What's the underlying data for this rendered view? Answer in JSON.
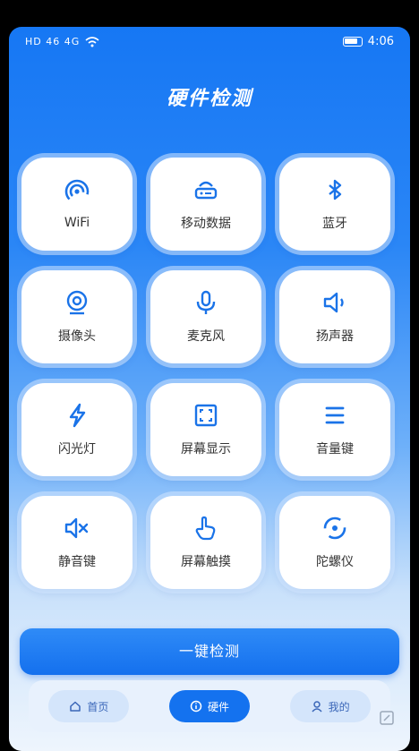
{
  "status_bar": {
    "time": "4:06",
    "signal_text": "HD 46 4G"
  },
  "header": {
    "title": "硬件检测"
  },
  "grid": {
    "items": [
      {
        "label": "WiFi",
        "icon": "wifi-icon"
      },
      {
        "label": "移动数据",
        "icon": "router-icon"
      },
      {
        "label": "蓝牙",
        "icon": "bluetooth-icon"
      },
      {
        "label": "摄像头",
        "icon": "camera-icon"
      },
      {
        "label": "麦克风",
        "icon": "microphone-icon"
      },
      {
        "label": "扬声器",
        "icon": "speaker-icon"
      },
      {
        "label": "闪光灯",
        "icon": "flash-icon"
      },
      {
        "label": "屏幕显示",
        "icon": "screen-icon"
      },
      {
        "label": "音量键",
        "icon": "volume-keys-icon"
      },
      {
        "label": "静音键",
        "icon": "mute-icon"
      },
      {
        "label": "屏幕触摸",
        "icon": "touch-icon"
      },
      {
        "label": "陀螺仪",
        "icon": "gyroscope-icon"
      }
    ]
  },
  "actions": {
    "check_all": "一键检测"
  },
  "nav": {
    "items": [
      {
        "label": "首页",
        "icon": "home-icon",
        "active": false
      },
      {
        "label": "硬件",
        "icon": "info-icon",
        "active": true
      },
      {
        "label": "我的",
        "icon": "user-icon",
        "active": false
      }
    ]
  },
  "colors": {
    "accent": "#1472ef",
    "icon_blue": "#1a73e8",
    "background_top": "#1677f4"
  }
}
